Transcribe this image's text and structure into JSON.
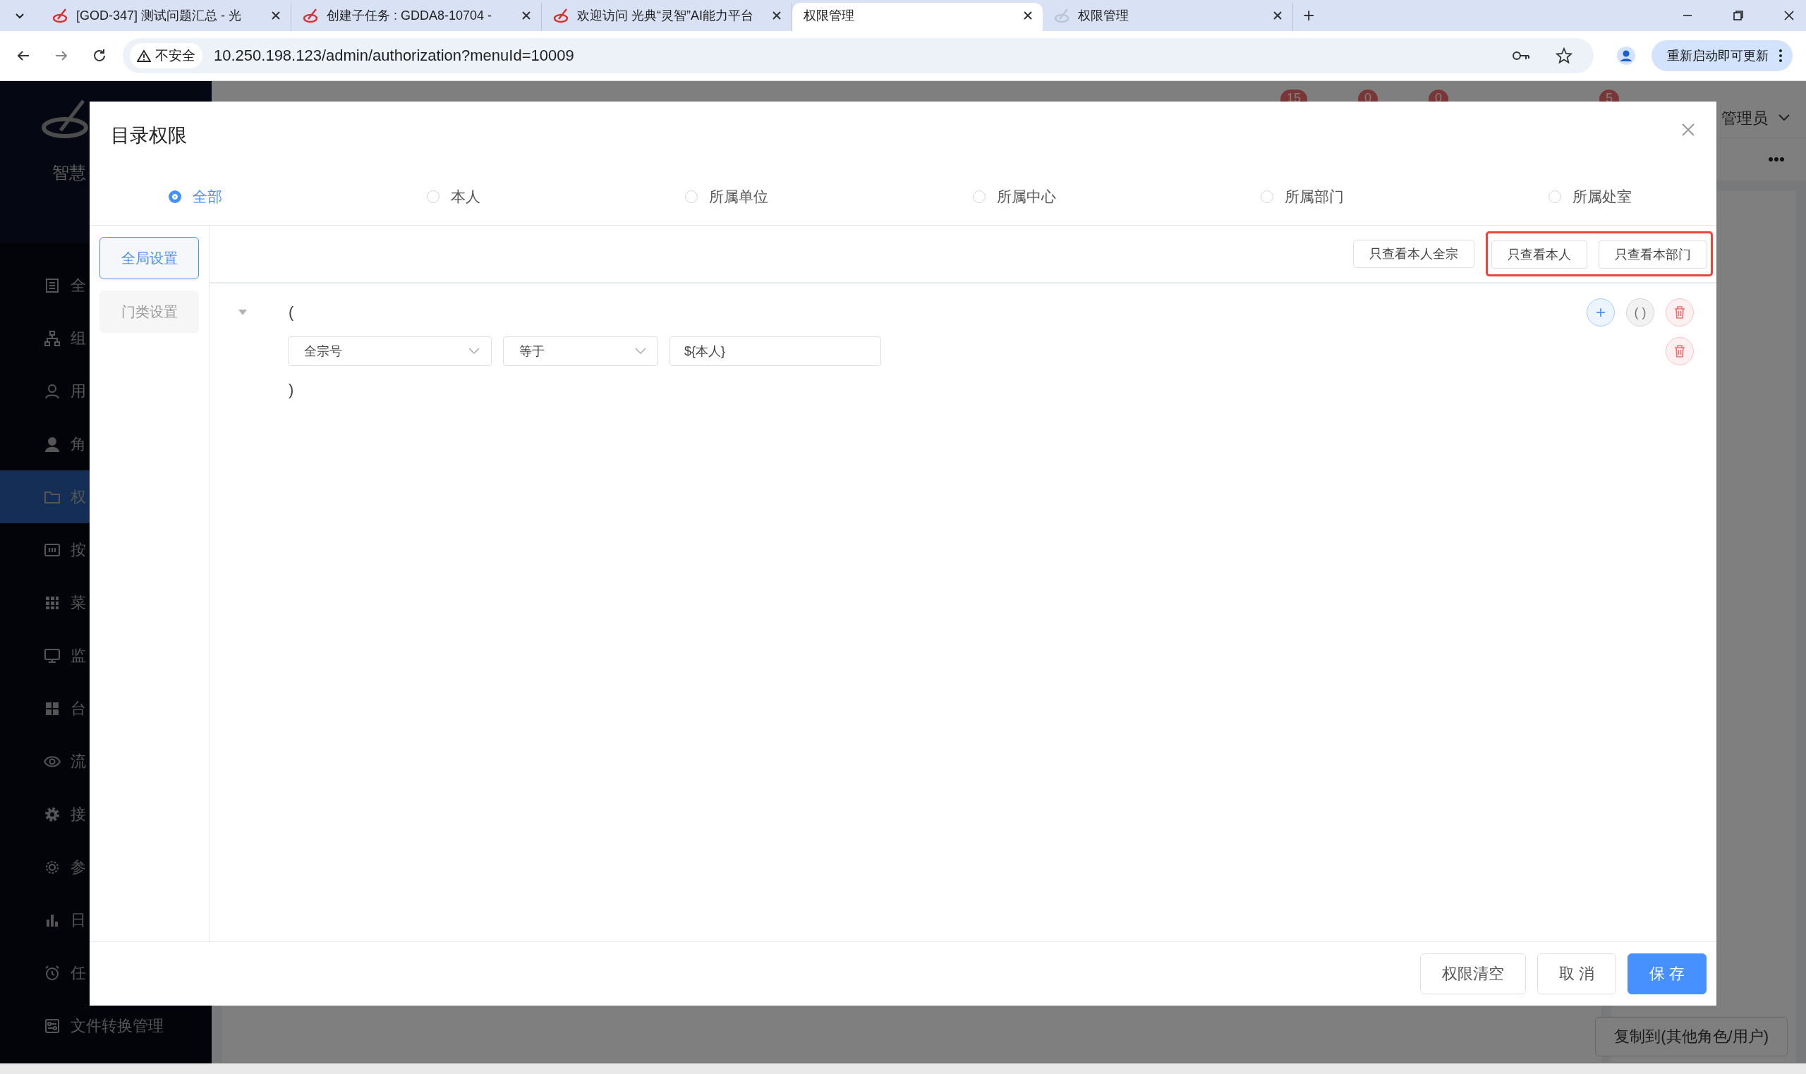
{
  "browser": {
    "tabs": [
      {
        "title": "[GOD-347] 测试问题汇总 - 光",
        "selected": false
      },
      {
        "title": "创建子任务 : GDDA8-10704 -",
        "selected": false
      },
      {
        "title": "欢迎访问 光典“灵智”AI能力平台",
        "selected": false
      },
      {
        "title": "权限管理",
        "selected": true
      },
      {
        "title": "权限管理",
        "selected": false
      }
    ],
    "new_tab": "+",
    "security_label": "不安全",
    "url": "10.250.198.123/admin/authorization?menuId=10009",
    "update_button": "重新启动即可更新"
  },
  "sidebar": {
    "logo_text": "智慧",
    "items": [
      {
        "label": "全",
        "selected": false
      },
      {
        "label": "组",
        "selected": false
      },
      {
        "label": "用",
        "selected": false
      },
      {
        "label": "角",
        "selected": false
      },
      {
        "label": "权",
        "selected": true
      },
      {
        "label": "按",
        "selected": false
      },
      {
        "label": "菜",
        "selected": false
      },
      {
        "label": "监",
        "selected": false
      },
      {
        "label": "台",
        "selected": false
      },
      {
        "label": "流",
        "selected": false
      },
      {
        "label": "接",
        "selected": false
      },
      {
        "label": "参",
        "selected": false
      },
      {
        "label": "日",
        "selected": false
      },
      {
        "label": "任",
        "selected": false
      },
      {
        "label": "文件转换管理",
        "selected": false
      }
    ]
  },
  "header": {
    "badges": [
      "15",
      "0",
      "0",
      "5"
    ],
    "user": "管理员"
  },
  "page": {
    "copy_button": "复制到(其他角色/用户)"
  },
  "dialog": {
    "title": "目录权限",
    "scopes": [
      {
        "label": "全部",
        "selected": true
      },
      {
        "label": "本人",
        "selected": false
      },
      {
        "label": "所属单位",
        "selected": false
      },
      {
        "label": "所属中心",
        "selected": false
      },
      {
        "label": "所属部门",
        "selected": false
      },
      {
        "label": "所属处室",
        "selected": false
      }
    ],
    "tabs": [
      {
        "label": "全局设置",
        "selected": true,
        "disabled": false
      },
      {
        "label": "门类设置",
        "selected": false,
        "disabled": true
      }
    ],
    "presets": [
      {
        "label": "只查看本人全宗",
        "highlighted": false
      },
      {
        "label": "只查看本人",
        "highlighted": true
      },
      {
        "label": "只查看本部门",
        "highlighted": true
      }
    ],
    "rule": {
      "expanded": true,
      "open": "(",
      "close": ")",
      "group_actions": [
        "+",
        "( )"
      ],
      "conditions": [
        {
          "field": "全宗号",
          "operator": "等于",
          "value": "${本人}"
        }
      ]
    },
    "footer_buttons": [
      {
        "label": "权限清空",
        "kind": "default"
      },
      {
        "label": "取 消",
        "kind": "default"
      },
      {
        "label": "保 存",
        "kind": "primary"
      }
    ]
  }
}
